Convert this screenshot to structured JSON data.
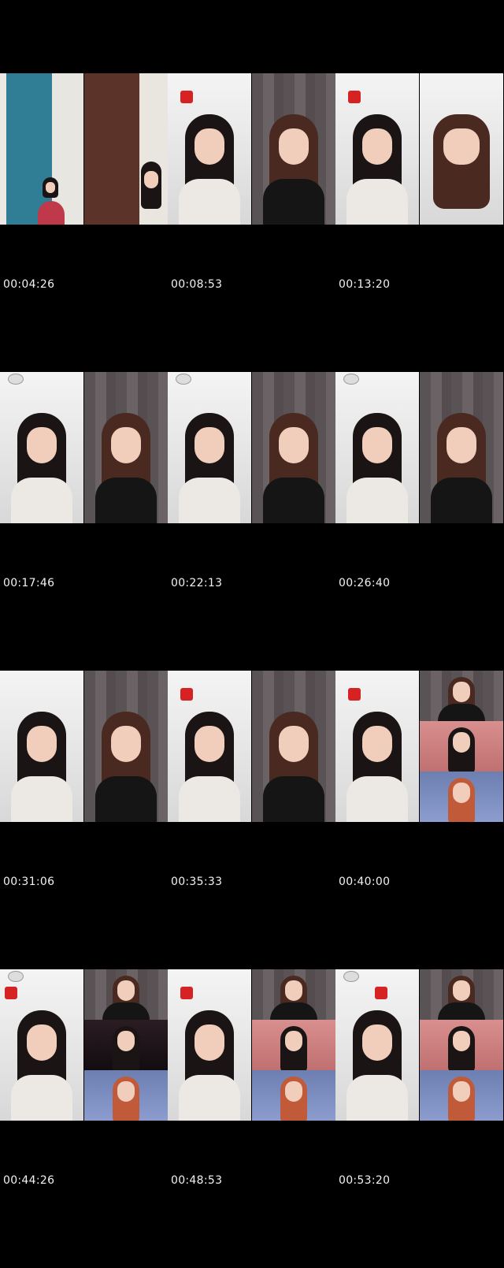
{
  "timestamps": [
    "00:04:26",
    "00:08:53",
    "00:13:20",
    "00:17:46",
    "00:22:13",
    "00:26:40",
    "00:31:06",
    "00:35:33",
    "00:40:00",
    "00:44:26",
    "00:48:53",
    "00:53:20"
  ],
  "thumbnails": [
    {
      "id": "t1",
      "left": "door",
      "right": "brown-door"
    },
    {
      "id": "t2",
      "left": "room",
      "right": "curtain"
    },
    {
      "id": "t3",
      "left": "room",
      "right": "room"
    },
    {
      "id": "t4",
      "left": "room",
      "right": "curtain"
    },
    {
      "id": "t5",
      "left": "room",
      "right": "curtain"
    },
    {
      "id": "t6",
      "left": "room",
      "right": "curtain"
    },
    {
      "id": "t7",
      "left": "room",
      "right": "curtain"
    },
    {
      "id": "t8",
      "left": "room",
      "right": "curtain"
    },
    {
      "id": "t9",
      "left": "room",
      "right": "split"
    },
    {
      "id": "t10",
      "left": "room",
      "right": "split"
    },
    {
      "id": "t11",
      "left": "room",
      "right": "split"
    },
    {
      "id": "t12",
      "left": "room",
      "right": "split"
    }
  ]
}
